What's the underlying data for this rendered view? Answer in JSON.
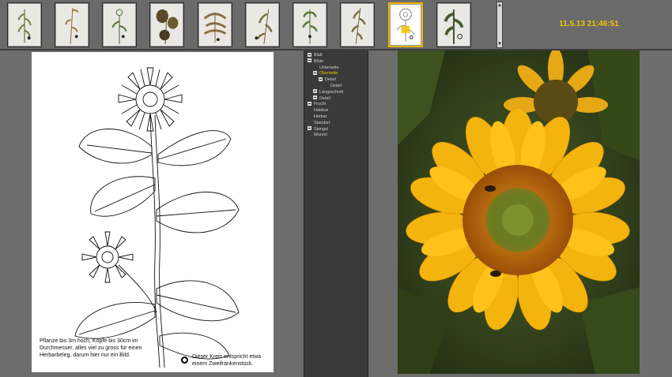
{
  "timestamp": "11.5.13 21:46:51",
  "thumbnails": [
    {
      "name": "thumb-1",
      "selected": false
    },
    {
      "name": "thumb-2",
      "selected": false
    },
    {
      "name": "thumb-3",
      "selected": false
    },
    {
      "name": "thumb-4",
      "selected": false
    },
    {
      "name": "thumb-5",
      "selected": false
    },
    {
      "name": "thumb-6",
      "selected": false
    },
    {
      "name": "thumb-7",
      "selected": false
    },
    {
      "name": "thumb-8",
      "selected": false
    },
    {
      "name": "thumb-9",
      "selected": true
    },
    {
      "name": "thumb-10",
      "selected": false
    }
  ],
  "tree": {
    "items": [
      {
        "label": "Blatt",
        "depth": 0,
        "expander": true,
        "active": false
      },
      {
        "label": "Blüte",
        "depth": 0,
        "expander": true,
        "active": false
      },
      {
        "label": "Unterseite",
        "depth": 1,
        "expander": false,
        "active": false
      },
      {
        "label": "Oberseite",
        "depth": 1,
        "expander": true,
        "active": true
      },
      {
        "label": "Detail",
        "depth": 2,
        "expander": true,
        "active": false
      },
      {
        "label": "Detail",
        "depth": 3,
        "expander": false,
        "active": false
      },
      {
        "label": "Längsschnitt",
        "depth": 1,
        "expander": true,
        "active": false
      },
      {
        "label": "Detail",
        "depth": 1,
        "expander": true,
        "active": false
      },
      {
        "label": "Frucht",
        "depth": 0,
        "expander": true,
        "active": false
      },
      {
        "label": "Habitus",
        "depth": 0,
        "expander": false,
        "active": false
      },
      {
        "label": "Herbar",
        "depth": 0,
        "expander": false,
        "active": false
      },
      {
        "label": "Standort",
        "depth": 0,
        "expander": false,
        "active": false
      },
      {
        "label": "Stengel",
        "depth": 0,
        "expander": true,
        "active": false
      },
      {
        "label": "Wurzel",
        "depth": 0,
        "expander": false,
        "active": false
      }
    ]
  },
  "drawing": {
    "caption": "Pflanze bis 3m hoch, Köpfe bis 30cm im Durchmesser, alles viel zu gross für einen Herbarbeleg, darum hier nur ein Bild.",
    "circle_note": "Dieser Kreis entspricht etwa einem Zweifrankenstück."
  },
  "colors": {
    "accent": "#f2c300",
    "selected_border": "#e8b400",
    "tree_bg": "#3a3a3a",
    "panel_bg": "#6d6d6d"
  }
}
